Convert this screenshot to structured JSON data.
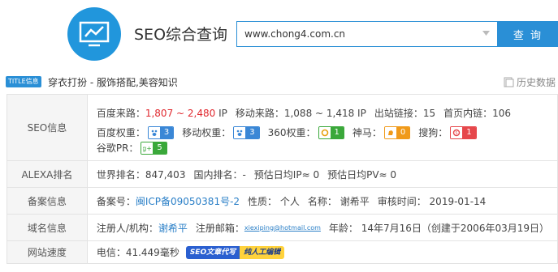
{
  "header": {
    "logo_icon": "chart-monitor-icon",
    "app_title": "SEO综合查询",
    "search": {
      "value": "www.chong4.com.cn"
    },
    "search_button": "查 询"
  },
  "title_row": {
    "tag": "TITLE信息",
    "text": "穿衣打扮 - 服饰搭配,美容知识",
    "history": "历史数据"
  },
  "rows": {
    "seo": {
      "label": "SEO信息",
      "baidu_source_label": "百度来路：",
      "baidu_source_value": "1,807 ~ 2,480",
      "baidu_source_unit": "IP",
      "mobile_source": "移动来路：1,088 ~ 1,418 IP",
      "outbound_links": "出站链接：15",
      "home_inner_links": "首页内链：106",
      "baidu_weight_label": "百度权重：",
      "baidu_weight_value": "3",
      "mobile_weight_label": "移动权重：",
      "mobile_weight_value": "3",
      "w360_label": "360权重：",
      "w360_value": "1",
      "shenma_label": "神马：",
      "shenma_value": "0",
      "sogou_label": "搜狗：",
      "sogou_value": "1",
      "google_pr_label": "谷歌PR：",
      "google_pr_value": "5"
    },
    "alexa": {
      "label": "ALEXA排名",
      "world_rank": "世界排名：847,403",
      "domestic_rank": "国内排名：-",
      "daily_ip": "预估日均IP≈ 0",
      "daily_pv": "预估日均PV≈ 0"
    },
    "icp": {
      "label": "备案信息",
      "icp_label": "备案号：",
      "icp_value": "闽ICP备09050381号-2",
      "nature": "性质： 个人",
      "name_label": "名称：",
      "name_value": "谢希平",
      "review_time": "审核时间： 2019-01-14"
    },
    "domain": {
      "label": "域名信息",
      "registrant_label": "注册人/机构：",
      "registrant_value": "谢希平",
      "email_label": "注册邮箱：",
      "email_value": "xiexiping@hotmail.com",
      "age": "年龄： 14年7月16日（创建于2006年03月19日）"
    },
    "speed": {
      "label": "网站速度",
      "telecom": "电信：41.449毫秒",
      "banner_part1": "SEO文章代写",
      "banner_part2": "纯人工编辑"
    }
  }
}
